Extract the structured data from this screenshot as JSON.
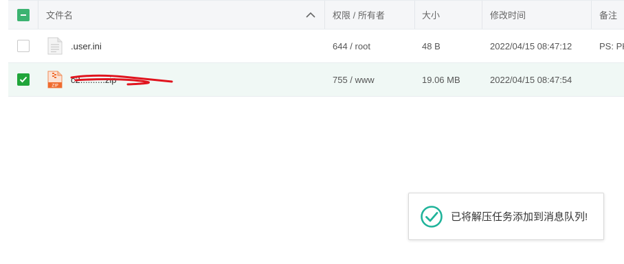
{
  "table": {
    "columns": {
      "name": "文件名",
      "permission": "权限 / 所有者",
      "size": "大小",
      "modified": "修改时间",
      "note": "备注"
    },
    "header_checkbox_state": "partial",
    "rows": [
      {
        "checked": false,
        "icon": "text-file-icon",
        "name": ".user.ini",
        "permission": "644 / root",
        "size": "48 B",
        "modified": "2022/04/15 08:47:12",
        "note": "PS: PH"
      },
      {
        "checked": true,
        "icon": "zip-file-icon",
        "name": "c2..........zip",
        "permission": "755 / www",
        "size": "19.06 MB",
        "modified": "2022/04/15 08:47:54",
        "note": ""
      }
    ]
  },
  "toast": {
    "message": "已将解压任务添加到消息队列!",
    "icon": "success-check-icon"
  },
  "colors": {
    "accent_green": "#20a53a",
    "toast_icon": "#1fb39a",
    "redaction": "#e0141e"
  }
}
